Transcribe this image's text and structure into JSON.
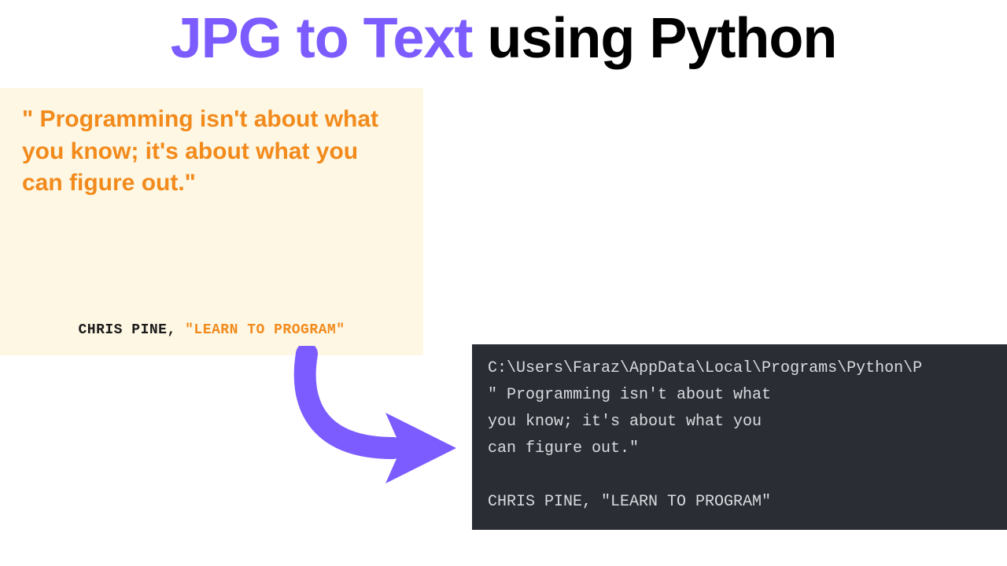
{
  "title": {
    "purple_part": "JPG to Text",
    "black_part": " using Python"
  },
  "quote_card": {
    "text": "\" Programming isn't about what you know; it's about what you can figure out.\"",
    "author": "CHRIS PINE, ",
    "book": "\"LEARN TO PROGRAM\""
  },
  "terminal": {
    "line1": "C:\\Users\\Faraz\\AppData\\Local\\Programs\\Python\\P",
    "line2": "\" Programming isn't about what",
    "line3": "you know; it's about what you",
    "line4": "can figure out.\"",
    "line5": "",
    "line6": "CHRIS PINE, \"LEARN TO PROGRAM\""
  },
  "colors": {
    "purple": "#7c5cff",
    "orange": "#f28a1c",
    "cream": "#fdf7e3",
    "dark_bg": "#2a2d33",
    "terminal_text": "#d8dce0"
  }
}
